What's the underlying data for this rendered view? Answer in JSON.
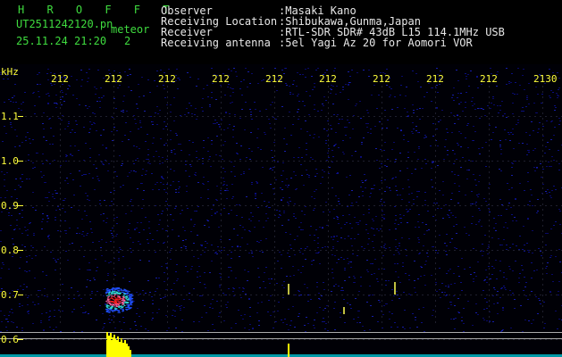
{
  "app": {
    "title": "H R O F F T",
    "filename": "UT2511242120.pn",
    "label": "meteor",
    "date": "25.11.24",
    "time": "21:20",
    "index": "2"
  },
  "info": {
    "labels": [
      "Observer",
      "Receiving Location",
      "Receiver",
      "Receiving antenna"
    ],
    "values": [
      ":Masaki Kano",
      ":Shibukawa,Gunma,Japan",
      ":RTL-SDR SDR# 43dB L15 114.1MHz USB",
      ":5el Yagi Az 20 for Aomori VOR"
    ]
  },
  "axes": {
    "y_unit": "kHz",
    "y_ticks": [
      "1.1",
      "1.0",
      "0.9",
      "0.8",
      "0.7",
      "0.6"
    ],
    "x_ticks": [
      "212",
      "212",
      "212",
      "212",
      "212",
      "212",
      "212",
      "212",
      "212",
      "2130"
    ]
  },
  "colors": {
    "background": "#000000",
    "noise": "#0a0a7a",
    "signal_hot": "#ff2020",
    "signal_warm": "#ffd000",
    "spectrum": "#ffff00",
    "baseline": "#aaaaaa"
  }
}
